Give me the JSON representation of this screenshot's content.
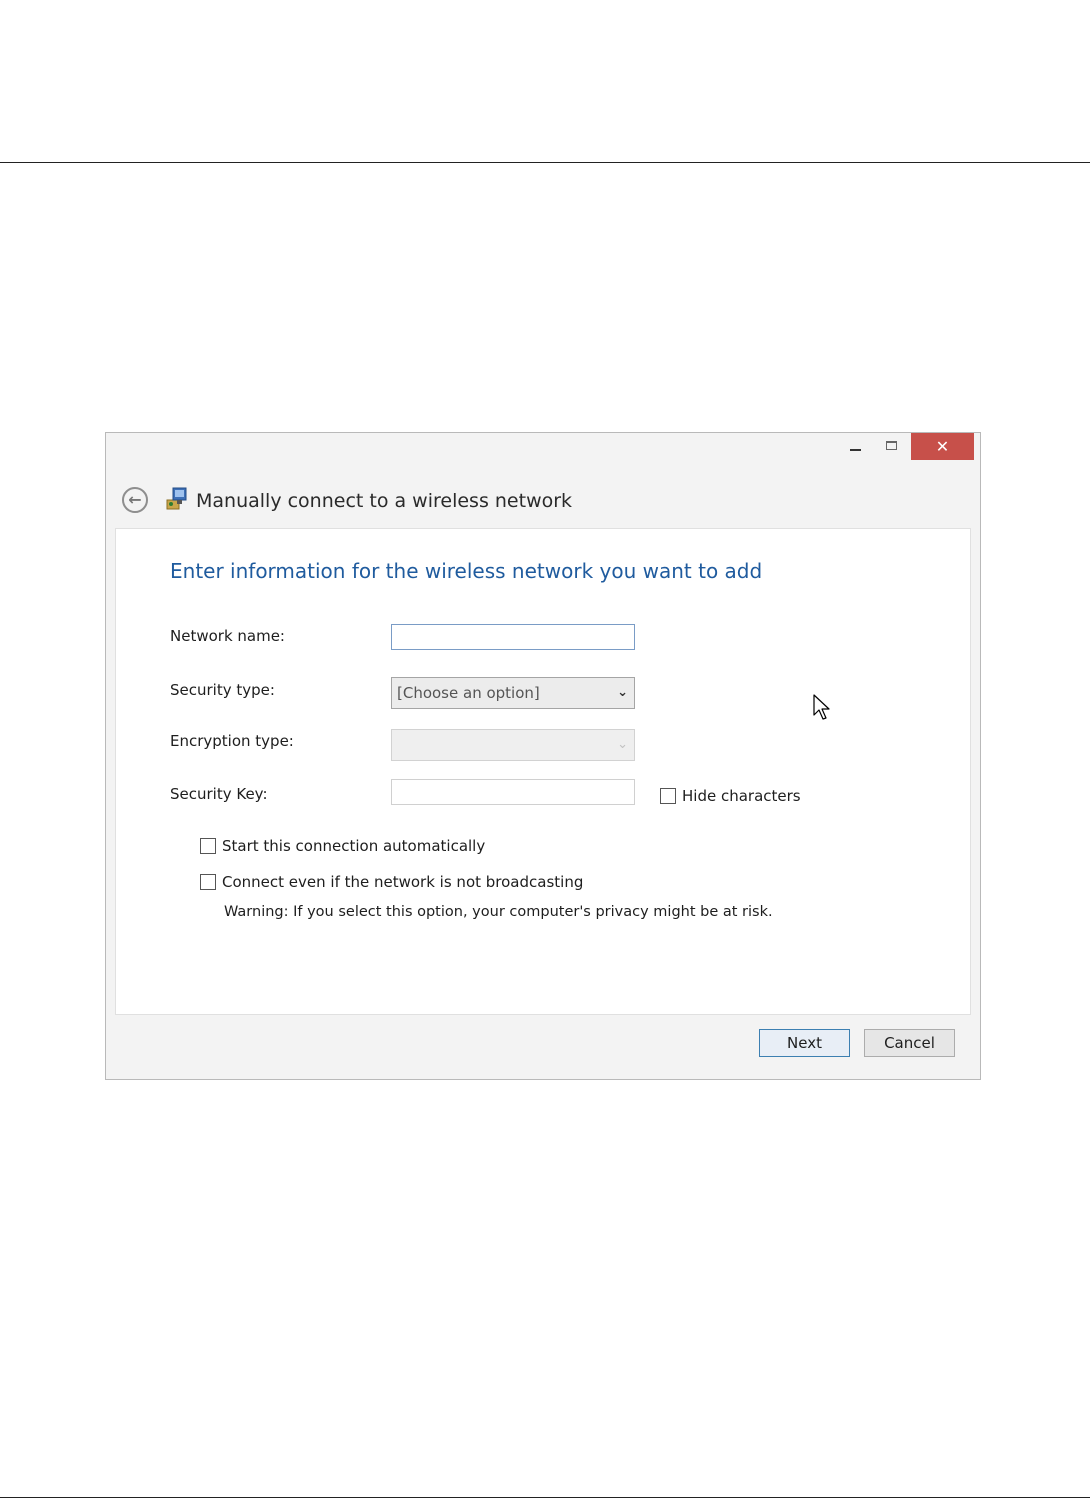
{
  "window": {
    "title": "Manually connect to a wireless network",
    "controls": {
      "minimize": "–",
      "maximize": "□",
      "close": "✕"
    },
    "close_color": "#c7504a"
  },
  "back_icon": "back-arrow-icon",
  "network_icon": "wireless-network-icon",
  "heading": "Enter information for the wireless network you want to add",
  "heading_color": "#1f5b9e",
  "form": {
    "network_name": {
      "label": "Network name:",
      "value": ""
    },
    "security_type": {
      "label": "Security type:",
      "selected": "[Choose an option]"
    },
    "encryption_type": {
      "label": "Encryption type:",
      "selected": ""
    },
    "security_key": {
      "label": "Security Key:",
      "value": ""
    },
    "hide_characters": {
      "label": "Hide characters",
      "checked": false
    }
  },
  "options": {
    "start_automatically": {
      "label": "Start this connection automatically",
      "checked": false
    },
    "connect_not_broadcasting": {
      "label": "Connect even if the network is not broadcasting",
      "checked": false
    },
    "warning": "Warning: If you select this option, your computer's privacy might be at risk."
  },
  "buttons": {
    "next": "Next",
    "cancel": "Cancel"
  }
}
